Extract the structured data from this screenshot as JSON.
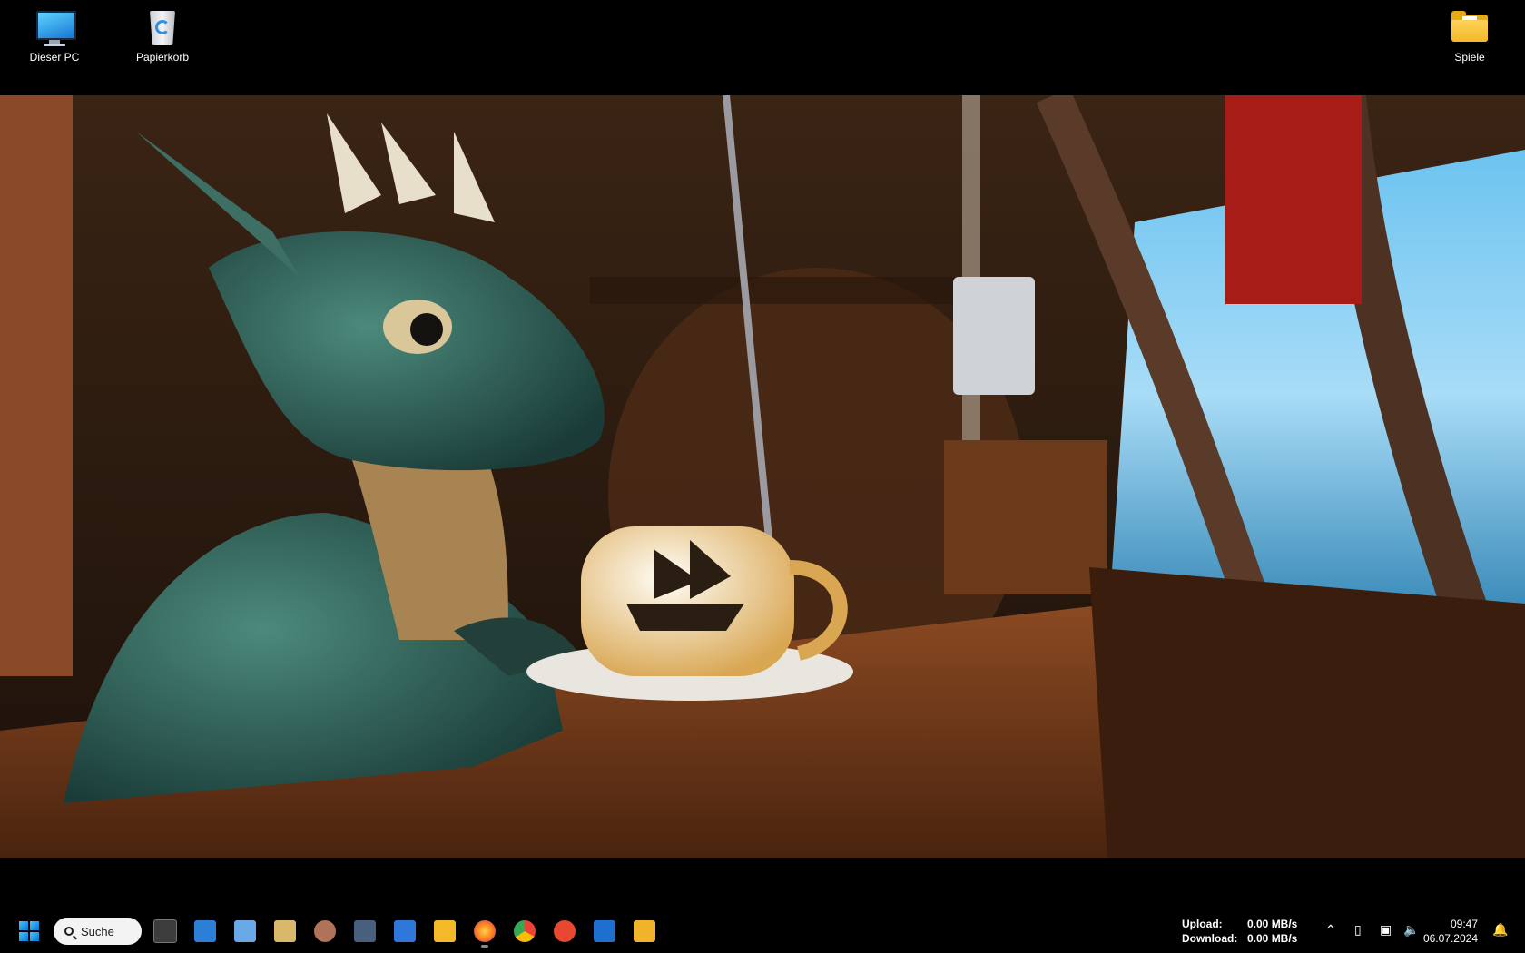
{
  "desktop": {
    "icons": [
      {
        "label": "Dieser PC",
        "icon": "monitor-icon"
      },
      {
        "label": "Papierkorb",
        "icon": "recycle-bin-icon"
      },
      {
        "label": "Spiele",
        "icon": "folder-icon"
      }
    ]
  },
  "wallpaper": {
    "subject": "dragon-with-coffee-cup-on-ship"
  },
  "taskbar": {
    "search_label": "Suche",
    "apps": [
      {
        "name": "terminal",
        "icon": "terminal-icon",
        "color": "#3c3c3c"
      },
      {
        "name": "disk-app",
        "icon": "disk-icon",
        "color": "#2b7fd6"
      },
      {
        "name": "control-panel",
        "icon": "control-panel-icon",
        "color": "#6aa9e8"
      },
      {
        "name": "xmind-like",
        "icon": "xd-icon",
        "color": "#d9b86c"
      },
      {
        "name": "image-viewer",
        "icon": "portrait-icon",
        "color": "#b0735a"
      },
      {
        "name": "network-tool",
        "icon": "network-icon",
        "color": "#47607d"
      },
      {
        "name": "id-app",
        "icon": "id-icon",
        "color": "#2f77d8"
      },
      {
        "name": "file-explorer",
        "icon": "folder-icon",
        "color": "#f3b928"
      },
      {
        "name": "firefox",
        "icon": "firefox-icon",
        "color": "#ff7a1a"
      },
      {
        "name": "chrome",
        "icon": "chrome-icon",
        "color": "#34a853"
      },
      {
        "name": "record-app",
        "icon": "record-icon",
        "color": "#e8482f"
      },
      {
        "name": "app-window",
        "icon": "window-icon",
        "color": "#1f6fd1"
      },
      {
        "name": "folder-app",
        "icon": "folder-icon",
        "color": "#f0b32a"
      }
    ],
    "net_monitor": {
      "upload_label": "Upload:",
      "upload_value": "0.00 MB/s",
      "download_label": "Download:",
      "download_value": "0.00 MB/s"
    },
    "clock": {
      "time": "09:47",
      "date": "06.07.2024"
    }
  }
}
